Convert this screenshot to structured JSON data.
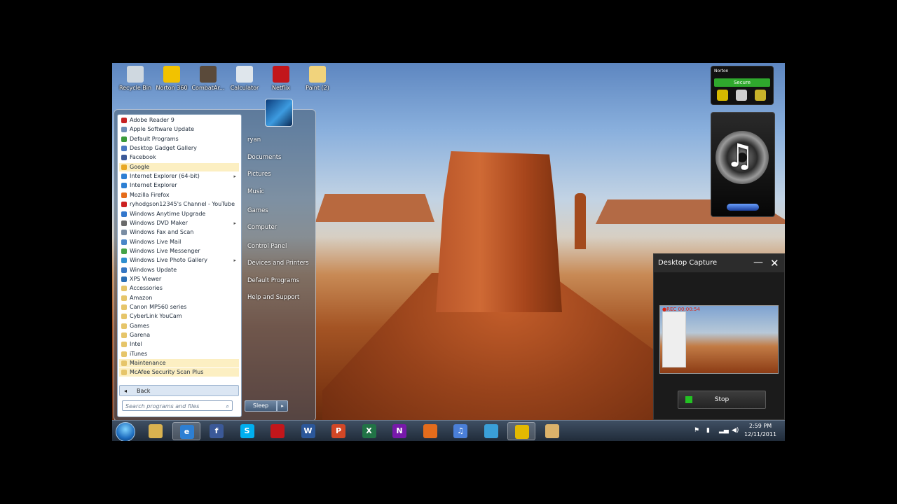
{
  "desktop_icons": [
    {
      "label": "Recycle Bin",
      "icon": "recycle-bin-icon",
      "color": "#cfd8e0"
    },
    {
      "label": "Norton 360",
      "icon": "norton-icon",
      "color": "#f2c200"
    },
    {
      "label": "CombatAr...",
      "icon": "game-icon",
      "color": "#5a4a3a"
    },
    {
      "label": "Calculator",
      "icon": "calculator-icon",
      "color": "#dfe6ec"
    },
    {
      "label": "Netflix",
      "icon": "netflix-icon",
      "color": "#c2161b"
    },
    {
      "label": "Paint (2)",
      "icon": "paint-icon",
      "color": "#f1d37c"
    }
  ],
  "start_menu": {
    "programs": [
      {
        "label": "Adobe Reader 9",
        "color": "#c62222"
      },
      {
        "label": "Apple Software Update",
        "color": "#6f8fb6"
      },
      {
        "label": "Default Programs",
        "color": "#3a9a3a"
      },
      {
        "label": "Desktop Gadget Gallery",
        "color": "#4a79c2"
      },
      {
        "label": "Facebook",
        "color": "#3b5998"
      },
      {
        "label": "Google",
        "color": "#e8a825",
        "highlight": true
      },
      {
        "label": "Internet Explorer (64-bit)",
        "color": "#2d7fd3"
      },
      {
        "label": "Internet Explorer",
        "color": "#2d7fd3"
      },
      {
        "label": "Mozilla Firefox",
        "color": "#e46c1c"
      },
      {
        "label": "ryhodgson12345's Channel - YouTube",
        "color": "#cc2020"
      },
      {
        "label": "Windows Anytime Upgrade",
        "color": "#3377cc"
      },
      {
        "label": "Windows DVD Maker",
        "color": "#6a6a6a"
      },
      {
        "label": "Windows Fax and Scan",
        "color": "#7a8da3"
      },
      {
        "label": "Windows Live Mail",
        "color": "#4a86c8"
      },
      {
        "label": "Windows Live Messenger",
        "color": "#45a348"
      },
      {
        "label": "Windows Live Photo Gallery",
        "color": "#2f8fcf"
      },
      {
        "label": "Windows Update",
        "color": "#3677c3"
      },
      {
        "label": "XPS Viewer",
        "color": "#2b6fb5"
      },
      {
        "label": "Accessories",
        "color": "#e6c56a"
      },
      {
        "label": "Amazon",
        "color": "#e6c56a"
      },
      {
        "label": "Canon MP560 series",
        "color": "#e6c56a"
      },
      {
        "label": "CyberLink YouCam",
        "color": "#e6c56a"
      },
      {
        "label": "Games",
        "color": "#e6c56a"
      },
      {
        "label": "Garena",
        "color": "#e6c56a"
      },
      {
        "label": "Intel",
        "color": "#e6c56a"
      },
      {
        "label": "iTunes",
        "color": "#e6c56a"
      },
      {
        "label": "Maintenance",
        "color": "#e6c56a",
        "highlight": true
      },
      {
        "label": "McAfee Security Scan Plus",
        "color": "#e6c56a",
        "highlight": true
      }
    ],
    "back_label": "Back",
    "search_placeholder": "Search programs and files",
    "right_links": [
      "ryan",
      "Documents",
      "Pictures",
      "Music",
      "Games",
      "Computer",
      "Control Panel",
      "Devices and Printers",
      "Default Programs",
      "Help and Support"
    ],
    "sleep_label": "Sleep"
  },
  "taskbar": {
    "pinned": [
      {
        "name": "explorer",
        "glyph": "",
        "color": "#d9b250"
      },
      {
        "name": "internet-explorer",
        "glyph": "e",
        "color": "#2d7fd3",
        "active": true
      },
      {
        "name": "facebook",
        "glyph": "f",
        "color": "#3b5998"
      },
      {
        "name": "skype",
        "glyph": "S",
        "color": "#00aff0"
      },
      {
        "name": "netflix",
        "glyph": "",
        "color": "#c2161b"
      },
      {
        "name": "word",
        "glyph": "W",
        "color": "#2b579a"
      },
      {
        "name": "powerpoint",
        "glyph": "P",
        "color": "#d24726"
      },
      {
        "name": "excel",
        "glyph": "X",
        "color": "#217346"
      },
      {
        "name": "onenote",
        "glyph": "N",
        "color": "#7719aa"
      },
      {
        "name": "firefox",
        "glyph": "",
        "color": "#e46c1c"
      },
      {
        "name": "itunes",
        "glyph": "♫",
        "color": "#4a7fd8"
      },
      {
        "name": "media-center",
        "glyph": "",
        "color": "#3a9fd8"
      },
      {
        "name": "norton",
        "glyph": "",
        "color": "#e4b900",
        "active": true
      },
      {
        "name": "paint",
        "glyph": "",
        "color": "#dcb26a"
      }
    ],
    "time": "2:59 PM",
    "date": "12/11/2011"
  },
  "norton_gadget": {
    "brand": "Norton",
    "status": "Secure"
  },
  "capture_window": {
    "title": "Desktop Capture",
    "rec_text": "●REC 00:00:54",
    "stop_label": "Stop"
  }
}
